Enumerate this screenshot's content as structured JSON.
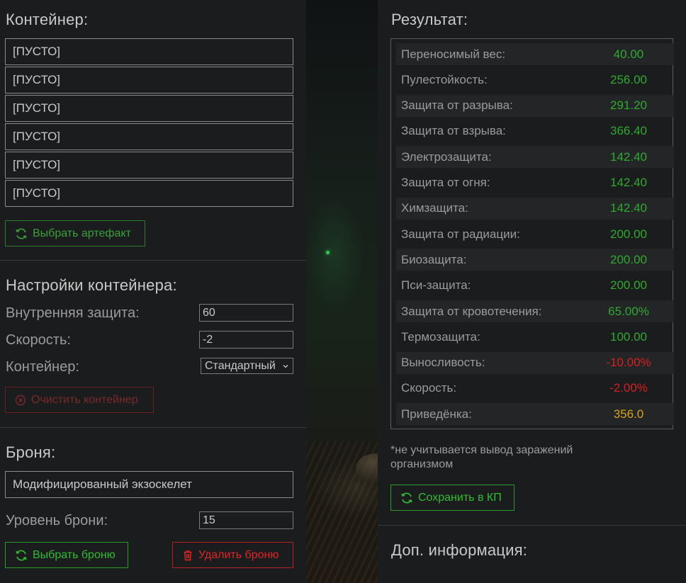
{
  "container": {
    "title": "Контейнер:",
    "slots": [
      "[ПУСТО]",
      "[ПУСТО]",
      "[ПУСТО]",
      "[ПУСТО]",
      "[ПУСТО]",
      "[ПУСТО]"
    ],
    "select_artifact_label": "Выбрать артефакт"
  },
  "container_settings": {
    "title": "Настройки контейнера:",
    "inner_protection_label": "Внутренняя защита:",
    "inner_protection_value": "60",
    "speed_label": "Скорость:",
    "speed_value": "-2",
    "container_label": "Контейнер:",
    "container_value": "Стандартный",
    "clear_label": "Очистить контейнер"
  },
  "armor": {
    "title": "Броня:",
    "name": "Модифицированный экзоскелет",
    "level_label": "Уровень брони:",
    "level_value": "15",
    "select_label": "Выбрать броню",
    "delete_label": "Удалить броню"
  },
  "result": {
    "title": "Результат:",
    "rows": [
      {
        "name": "Переносимый вес:",
        "value": "40.00",
        "color": "green"
      },
      {
        "name": "Пулестойкость:",
        "value": "256.00",
        "color": "green"
      },
      {
        "name": "Защита от разрыва:",
        "value": "291.20",
        "color": "green"
      },
      {
        "name": "Защита от взрыва:",
        "value": "366.40",
        "color": "green"
      },
      {
        "name": "Электрозащита:",
        "value": "142.40",
        "color": "green"
      },
      {
        "name": "Защита от огня:",
        "value": "142.40",
        "color": "green"
      },
      {
        "name": "Химзащита:",
        "value": "142.40",
        "color": "green"
      },
      {
        "name": "Защита от радиации:",
        "value": "200.00",
        "color": "green"
      },
      {
        "name": "Биозащита:",
        "value": "200.00",
        "color": "green"
      },
      {
        "name": "Пси-защита:",
        "value": "200.00",
        "color": "green"
      },
      {
        "name": "Защита от кровотечения:",
        "value": "65.00%",
        "color": "green"
      },
      {
        "name": "Термозащита:",
        "value": "100.00",
        "color": "green"
      },
      {
        "name": "Выносливость:",
        "value": "-10.00%",
        "color": "red"
      },
      {
        "name": "Скорость:",
        "value": "-2.00%",
        "color": "red"
      },
      {
        "name": "Приведёнка:",
        "value": "356.0",
        "color": "yellow"
      }
    ],
    "note_line1": "*не учитывается вывод заражений",
    "note_line2": "организмом",
    "save_label": "Сохранить в КП"
  },
  "extra": {
    "title": "Доп. информация:"
  },
  "colors": {
    "green": "#2faa2f",
    "red": "#d42020",
    "yellow": "#d6a31a",
    "background": "#1b1c1e"
  }
}
